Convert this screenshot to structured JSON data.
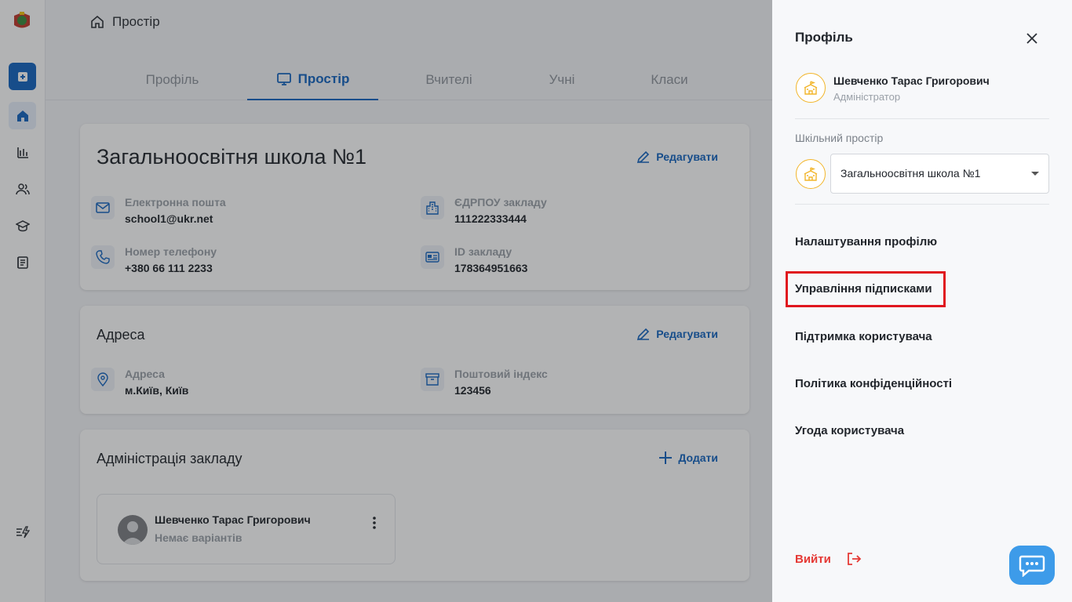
{
  "breadcrumb": {
    "label": "Простір"
  },
  "tabs": [
    {
      "label": "Профіль"
    },
    {
      "label": "Простір"
    },
    {
      "label": "Вчителі"
    },
    {
      "label": "Учні"
    },
    {
      "label": "Класи"
    }
  ],
  "school_card": {
    "title": "Загальноосвітня школа №1",
    "edit_label": "Редагувати",
    "fields": [
      {
        "label": "Електронна пошта",
        "value": "school1@ukr.net",
        "icon": "mail-icon"
      },
      {
        "label": "ЄДРПОУ закладу",
        "value": "111222333444",
        "icon": "building-icon"
      },
      {
        "label": "Номер телефону",
        "value": "+380 66 111 2233",
        "icon": "phone-icon"
      },
      {
        "label": "ID закладу",
        "value": "178364951663",
        "icon": "id-card-icon"
      }
    ]
  },
  "address_card": {
    "title": "Адреса",
    "edit_label": "Редагувати",
    "fields": [
      {
        "label": "Адреса",
        "value": "м.Київ, Київ",
        "icon": "location-pin-icon"
      },
      {
        "label": "Поштовий індекс",
        "value": "123456",
        "icon": "archive-box-icon"
      }
    ]
  },
  "admin_card": {
    "title": "Адміністрація закладу",
    "add_label": "Додати",
    "admin": {
      "name": "Шевченко Тарас Григорович",
      "subtitle": "Немає варіантів"
    }
  },
  "drawer": {
    "title": "Профіль",
    "user": {
      "name": "Шевченко Тарас Григорович",
      "role": "Адміністратор"
    },
    "space_label": "Шкільний простір",
    "selected_school": "Загальноосвітня школа №1",
    "menu": [
      {
        "label": "Налаштування профілю"
      },
      {
        "label": "Управління підписками"
      },
      {
        "label": "Підтримка користувача"
      },
      {
        "label": "Політика конфіденційності"
      },
      {
        "label": "Угода користувача"
      }
    ],
    "logout_label": "Вийти"
  },
  "colors": {
    "primary": "#1565c0",
    "highlight": "#e0161e",
    "logout": "#e53935",
    "badge_border": "#f2b52a",
    "chat": "#3d9be9"
  }
}
